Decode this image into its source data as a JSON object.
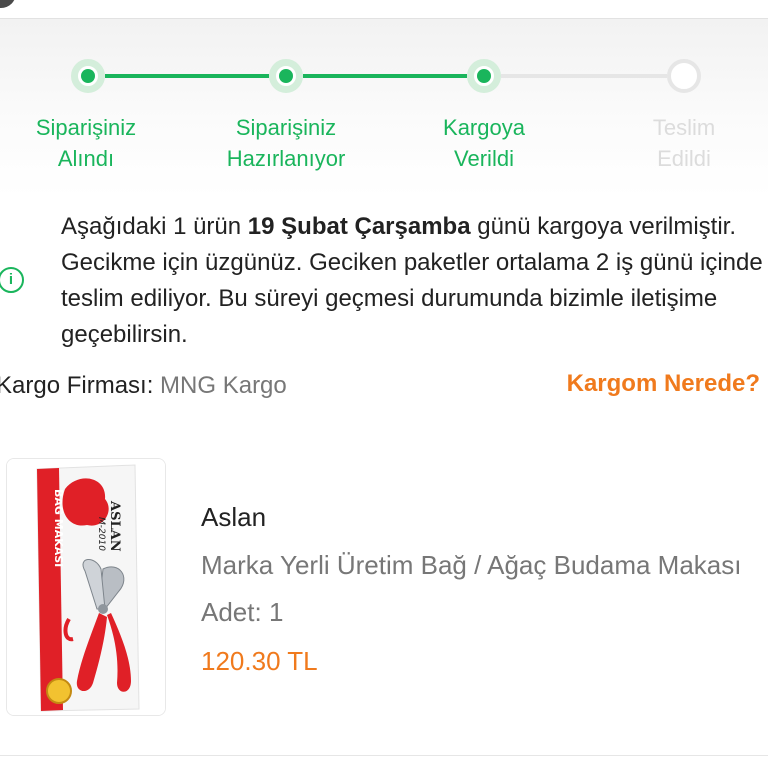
{
  "colors": {
    "success": "#1ab55c",
    "accent": "#f07a1d",
    "muted_text": "#777777",
    "pending": "#e6e6e6"
  },
  "tracker": {
    "steps": [
      {
        "label": "Siparişiniz\nAlındı",
        "status": "done"
      },
      {
        "label": "Siparişiniz\nHazırlanıyor",
        "status": "done"
      },
      {
        "label": "Kargoya\nVerildi",
        "status": "done"
      },
      {
        "label": "Teslim\nEdildi",
        "status": "pending"
      }
    ]
  },
  "message": {
    "icon": "info-icon",
    "part1": "Aşağıdaki 1 ürün ",
    "date": "19 Şubat Çarşamba",
    "part2": " günü kargoya verilmiştir. Gecikme için üzgünüz. Geciken paketler ortalama 2 iş günü içinde teslim ediliyor. Bu süreyi geçmesi durumunda bizimle iletişime geçebilirsin."
  },
  "cargo": {
    "label": "Kargo Firması:",
    "value": "MNG Kargo",
    "link": "Kargom Nerede?"
  },
  "product": {
    "brand": "Aslan",
    "name": "Marka Yerli Üretim Bağ / Ağaç Budama Makası",
    "qty_label": "Adet:",
    "qty": "1",
    "price": "120.30 TL",
    "image": {
      "label_top": "ASLAN",
      "model": "M-2010",
      "side_text": "BAĞ MAKASI"
    }
  }
}
